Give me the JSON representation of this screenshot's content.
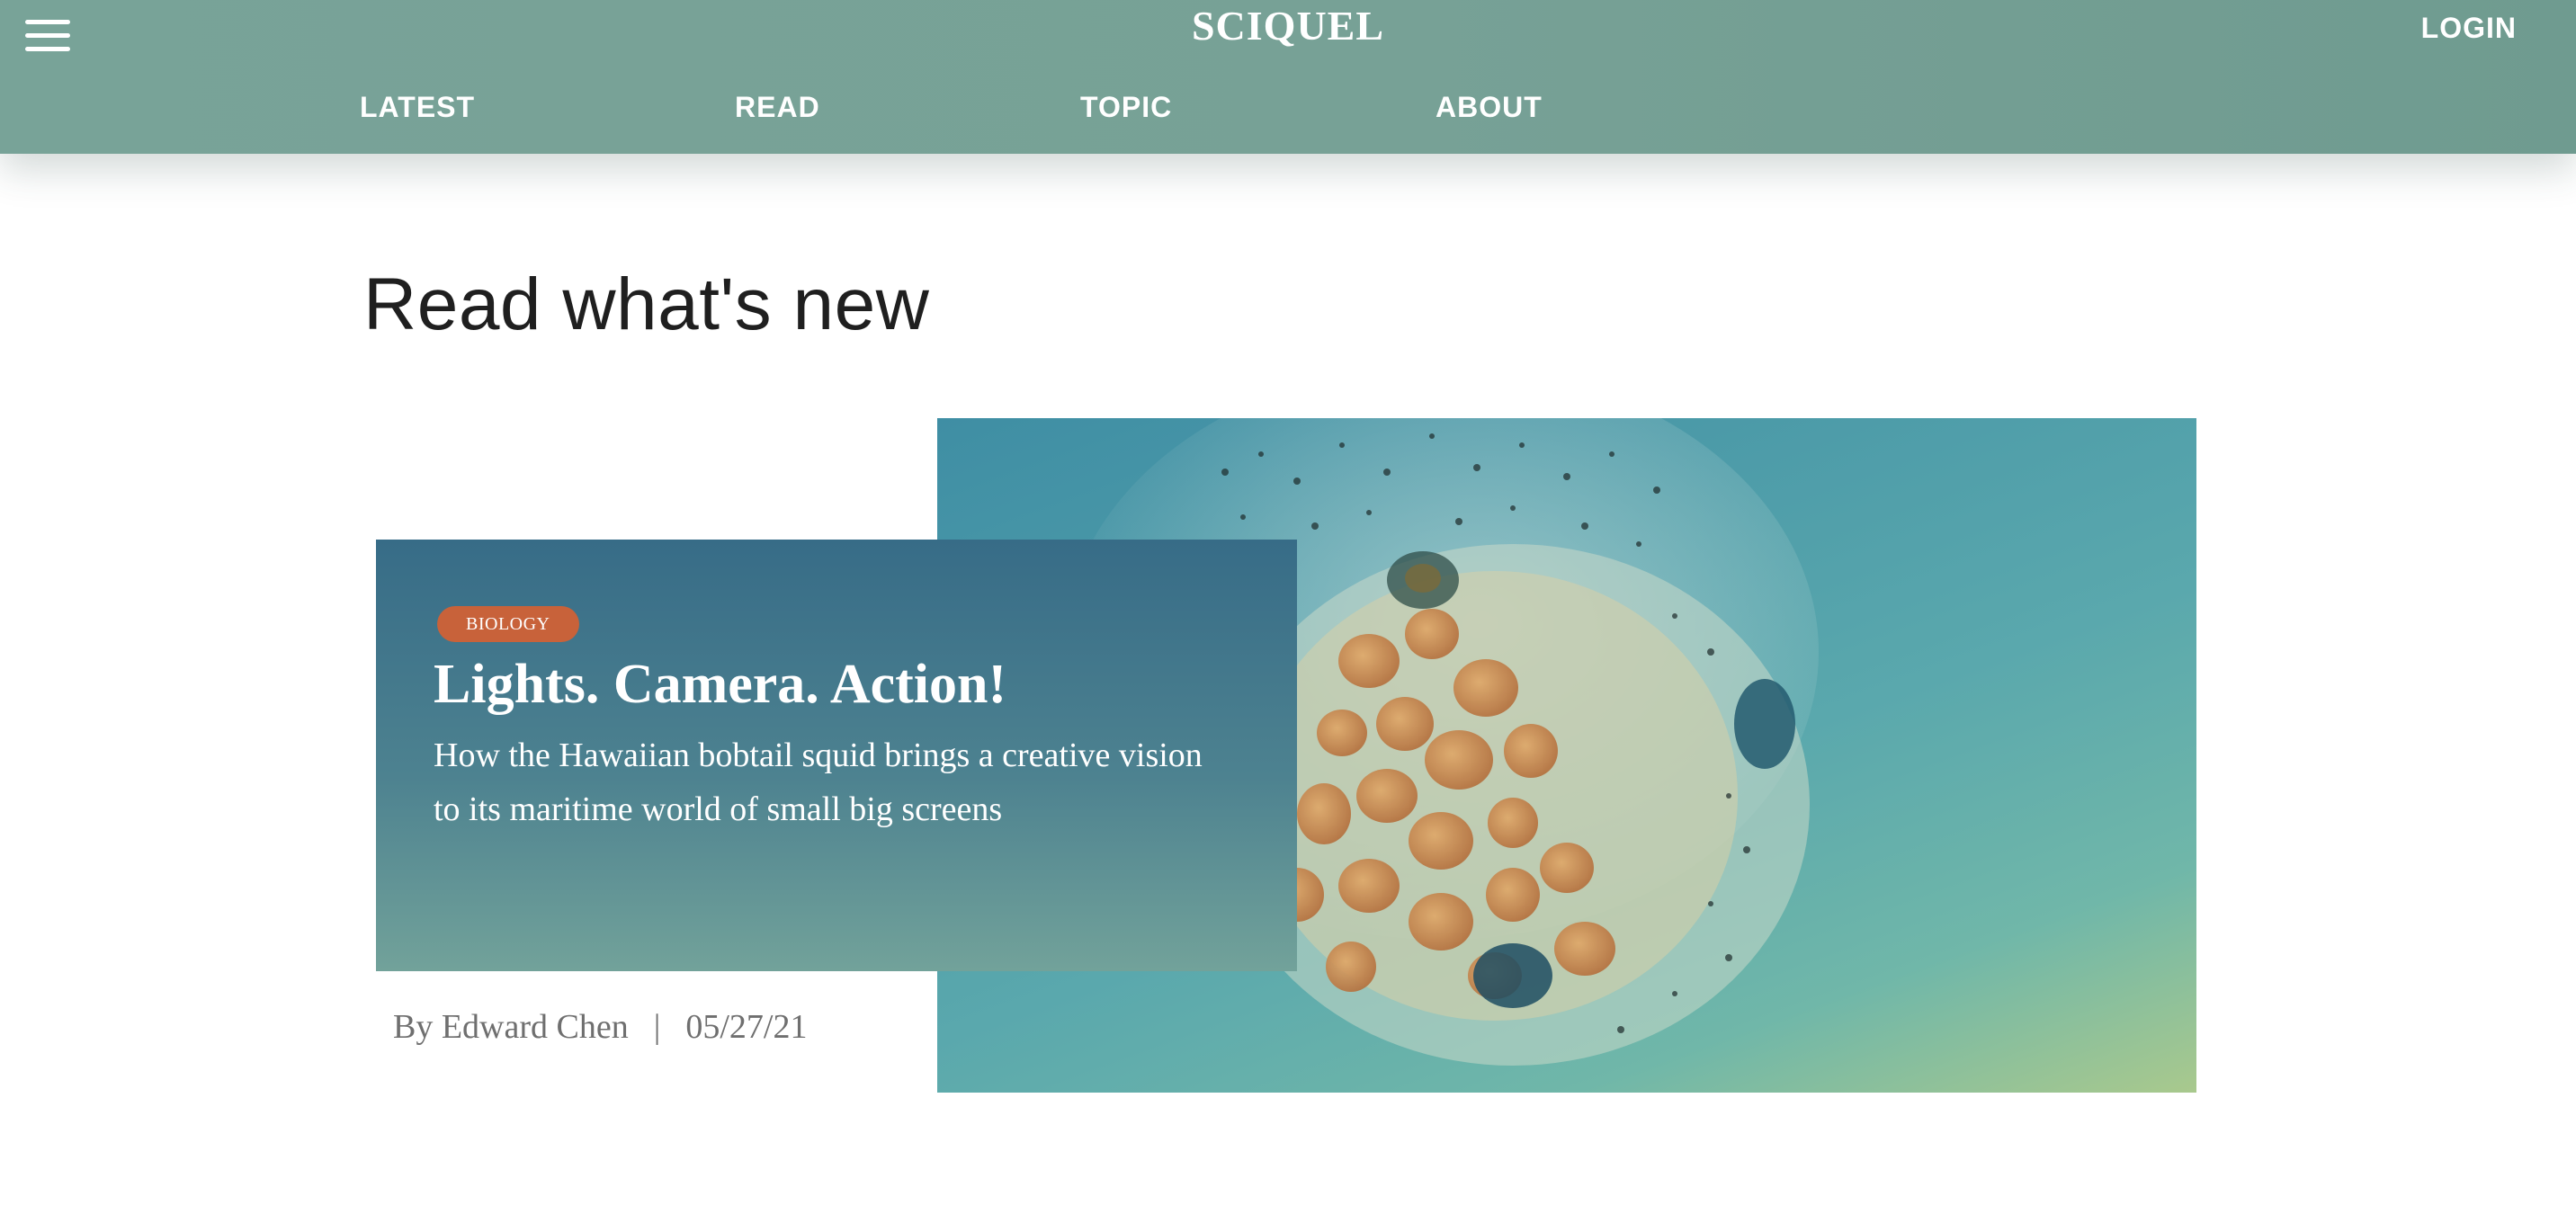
{
  "header": {
    "brand": "SCIQUEL",
    "login_label": "LOGIN",
    "menu_icon": "hamburger-menu-icon",
    "background_color": "#77a196",
    "nav": [
      {
        "label": "LATEST"
      },
      {
        "label": "READ"
      },
      {
        "label": "TOPIC"
      },
      {
        "label": "ABOUT"
      }
    ]
  },
  "main": {
    "section_title": "Read what's new",
    "featured": {
      "category": "BIOLOGY",
      "title": "Lights. Camera. Action!",
      "subtitle": "How the Hawaiian bobtail squid brings a creative vision to its maritime world of small big screens",
      "author": "By Edward Chen",
      "separator": "|",
      "date": "05/27/21",
      "category_color": "#c8623a",
      "card_color": "#376c87"
    }
  }
}
